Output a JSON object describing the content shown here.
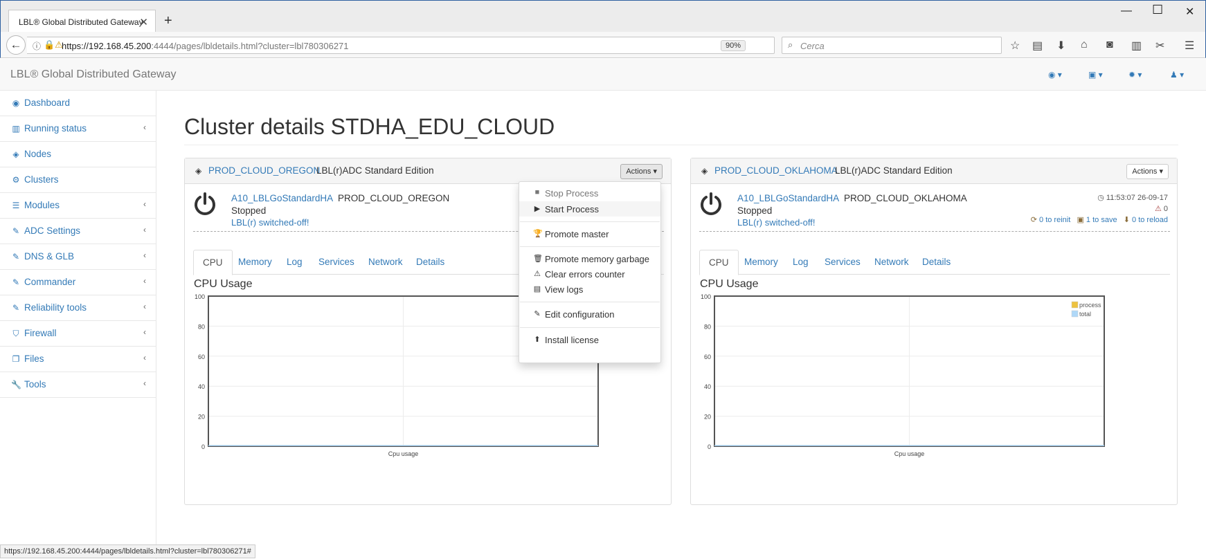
{
  "browser": {
    "tab_title": "LBL® Global Distributed Gateway",
    "url_host": "https://192.168.45.200",
    "url_rest": ":4444/pages/lbldetails.html?cluster=lbl780306271",
    "zoom": "90%",
    "search_placeholder": "Cerca",
    "status_url": "https://192.168.45.200:4444/pages/lbldetails.html?cluster=lbl780306271#"
  },
  "app": {
    "brand": "LBL® Global Distributed Gateway",
    "header_menus": [
      "dashboard-menu",
      "save-menu",
      "settings-menu",
      "user-menu"
    ]
  },
  "sidebar": {
    "items": [
      {
        "label": "Dashboard",
        "icon": "dashboard-icon",
        "has_submenu": false
      },
      {
        "label": "Running status",
        "icon": "bar-chart-icon",
        "has_submenu": true
      },
      {
        "label": "Nodes",
        "icon": "cube-icon",
        "has_submenu": false
      },
      {
        "label": "Clusters",
        "icon": "cogs-icon",
        "has_submenu": false
      },
      {
        "label": "Modules",
        "icon": "list-icon",
        "has_submenu": true
      },
      {
        "label": "ADC Settings",
        "icon": "edit-icon",
        "has_submenu": true
      },
      {
        "label": "DNS & GLB",
        "icon": "edit-icon",
        "has_submenu": true
      },
      {
        "label": "Commander",
        "icon": "edit-icon",
        "has_submenu": true
      },
      {
        "label": "Reliability tools",
        "icon": "edit-icon",
        "has_submenu": true
      },
      {
        "label": "Firewall",
        "icon": "shield-icon",
        "has_submenu": true
      },
      {
        "label": "Files",
        "icon": "files-icon",
        "has_submenu": true
      },
      {
        "label": "Tools",
        "icon": "wrench-icon",
        "has_submenu": true
      }
    ]
  },
  "page": {
    "title": "Cluster details STDHA_EDU_CLOUD"
  },
  "panels": [
    {
      "cluster_link": "PROD_CLOUD_OREGON",
      "edition": "LBL(r)ADC Standard Edition",
      "actions_label": "Actions",
      "node_link": "A10_LBLGoStandardHA",
      "node_name": "PROD_CLOUD_OREGON",
      "status": "Stopped",
      "message": "LBL(r) switched-off!",
      "tabs": [
        "CPU",
        "Memory",
        "Log",
        "Services",
        "Network",
        "Details"
      ],
      "active_tab": "CPU",
      "chart_heading": "CPU Usage"
    },
    {
      "cluster_link": "PROD_CLOUD_OKLAHOMA",
      "edition": "LBL(r)ADC Standard Edition",
      "actions_label": "Actions",
      "node_link": "A10_LBLGoStandardHA",
      "node_name": "PROD_CLOUD_OKLAHOMA",
      "status": "Stopped",
      "message": "LBL(r) switched-off!",
      "timestamp": "11:53:07 26-09-17",
      "errors": "0",
      "to_reinit": "0 to reinit",
      "to_save": "1 to save",
      "to_reload": "0 to reload",
      "tabs": [
        "CPU",
        "Memory",
        "Log",
        "Services",
        "Network",
        "Details"
      ],
      "active_tab": "CPU",
      "chart_heading": "CPU Usage"
    }
  ],
  "actions_menu": {
    "items": [
      {
        "label": "Stop Process",
        "icon": "stop-icon",
        "disabled": true
      },
      {
        "label": "Start Process",
        "icon": "play-icon",
        "disabled": false,
        "hover": true
      },
      {
        "label": "Promote master",
        "icon": "trophy-icon",
        "disabled": false
      },
      {
        "label": "Promote memory garbage",
        "icon": "trash-icon",
        "disabled": false
      },
      {
        "label": "Clear errors counter",
        "icon": "warning-icon",
        "disabled": false
      },
      {
        "label": "View logs",
        "icon": "file-icon",
        "disabled": false
      },
      {
        "label": "Edit configuration",
        "icon": "edit-icon",
        "disabled": false
      },
      {
        "label": "Install license",
        "icon": "upload-icon",
        "disabled": false
      }
    ]
  },
  "chart_data": [
    {
      "type": "line",
      "title": "",
      "xlabel": "Cpu usage",
      "ylabel": "",
      "ylim": [
        0,
        100
      ],
      "yticks": [
        "0",
        "20",
        "40",
        "60",
        "80",
        "100"
      ],
      "series": [],
      "grid": true,
      "legend": "none"
    },
    {
      "type": "line",
      "title": "",
      "xlabel": "Cpu usage",
      "ylabel": "",
      "ylim": [
        0,
        100
      ],
      "yticks": [
        "0",
        "20",
        "40",
        "60",
        "80",
        "100"
      ],
      "series": [
        {
          "name": "process",
          "color": "#edc240",
          "values": []
        },
        {
          "name": "total",
          "color": "#afd8f8",
          "values": []
        }
      ],
      "grid": true,
      "legend": "top-right"
    }
  ]
}
